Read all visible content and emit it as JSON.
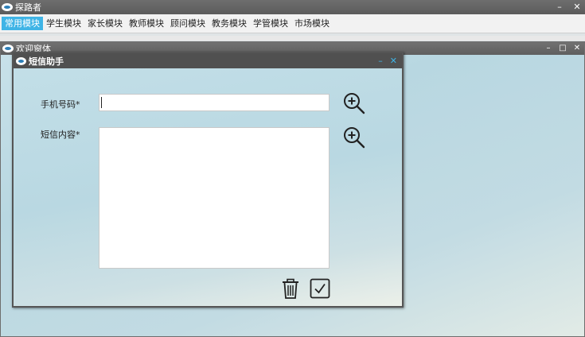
{
  "app": {
    "title": "探路者",
    "controls": {
      "minimize": "–",
      "close": "✕"
    }
  },
  "menu": {
    "items": [
      {
        "label": "常用模块",
        "active": true
      },
      {
        "label": "学生模块",
        "active": false
      },
      {
        "label": "家长模块",
        "active": false
      },
      {
        "label": "教师模块",
        "active": false
      },
      {
        "label": "顾问模块",
        "active": false
      },
      {
        "label": "教务模块",
        "active": false
      },
      {
        "label": "学管模块",
        "active": false
      },
      {
        "label": "市场模块",
        "active": false
      }
    ]
  },
  "welcome": {
    "title": "欢迎窗体",
    "controls": {
      "minimize": "–",
      "maximize": "□",
      "close": "✕"
    }
  },
  "dialog": {
    "title": "短信助手",
    "controls": {
      "minimize": "–",
      "close": "✕"
    },
    "phone_label": "手机号码*",
    "phone_value": "",
    "content_label": "短信内容*",
    "content_value": ""
  },
  "icons": {
    "phone_lookup": "zoom-in-icon",
    "content_lookup": "zoom-in-icon",
    "delete": "trash-icon",
    "confirm": "check-icon"
  }
}
